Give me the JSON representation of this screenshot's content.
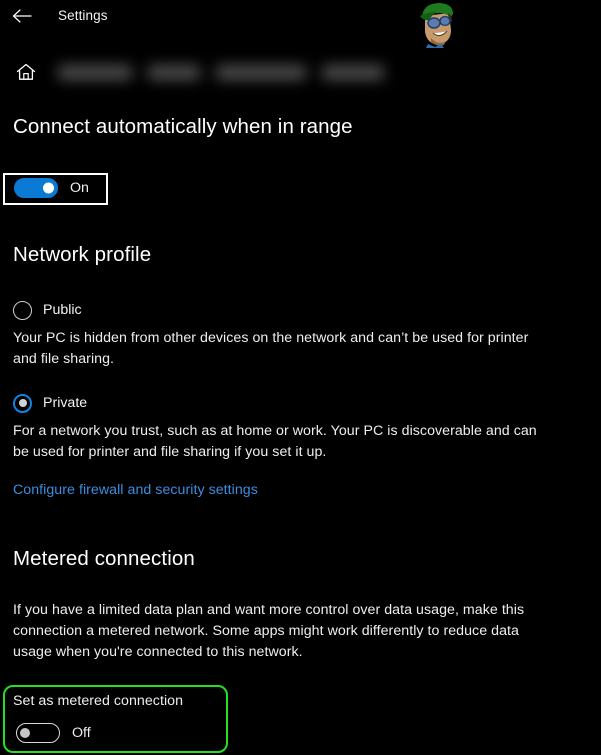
{
  "window": {
    "title": "Settings",
    "back_icon": "back-arrow-icon",
    "home_icon": "home-icon"
  },
  "breadcrumb": {
    "redacted": true,
    "note": "blurred network name crumbs"
  },
  "watermark": {
    "icon": "mascot-avatar-icon"
  },
  "connect_automatically": {
    "heading": "Connect automatically when in range",
    "toggle": {
      "state": "On",
      "label": "On",
      "on": true
    },
    "highlight_color": "#ffffff"
  },
  "network_profile": {
    "heading": "Network profile",
    "options": [
      {
        "label": "Public",
        "selected": false,
        "description": "Your PC is hidden from other devices on the network and can’t be used for printer and file sharing."
      },
      {
        "label": "Private",
        "selected": true,
        "description": "For a network you trust, such as at home or work. Your PC is discoverable and can be used for printer and file sharing if you set it up."
      }
    ],
    "link": "Configure firewall and security settings",
    "link_color": "#3b8ee0"
  },
  "metered_connection": {
    "heading": "Metered connection",
    "description": "If you have a limited data plan and want more control over data usage, make this connection a metered network. Some apps might work differently to reduce data usage when you're connected to this network.",
    "setting_label": "Set as metered connection",
    "toggle": {
      "state": "Off",
      "label": "Off",
      "on": false
    },
    "highlight_color": "#22e022"
  },
  "theme": {
    "background": "#000000",
    "accent": "#0a7ad4",
    "text": "#ffffff"
  }
}
